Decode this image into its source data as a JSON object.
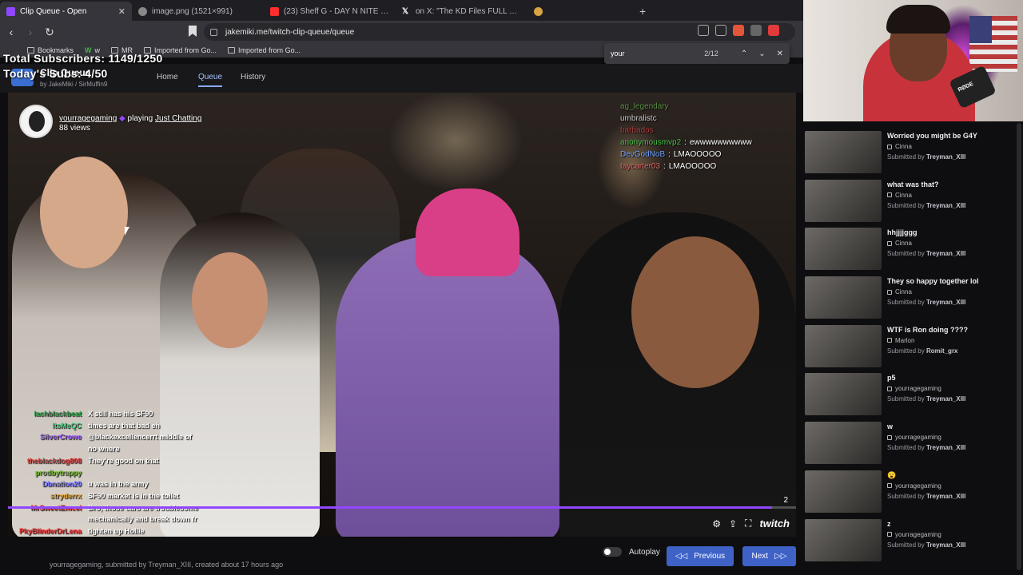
{
  "tabs": [
    {
      "title": "Clip Queue - Open",
      "color": "#9147ff",
      "active": true
    },
    {
      "title": "image.png (1521×991)",
      "color": "#888888"
    },
    {
      "title": "(23) Sheff G - DAY N NITE Freestyle (",
      "color": "#ff2d2d"
    },
    {
      "title": "on X: \"The KD Files FULL THREAD",
      "color": "#ffffff"
    },
    {
      "title": "",
      "color": "#d9a441"
    }
  ],
  "address": {
    "url": "jakemiki.me/twitch-clip-queue/queue"
  },
  "bookmarks": [
    "Bookmarks",
    "w",
    "MR",
    "Imported from Go...",
    "Imported from Go..."
  ],
  "find": {
    "query": "your",
    "count": "2/12"
  },
  "overlay": {
    "total_subs": "Total Subscribers: 1149/1250",
    "todays_subs": "Today's Subs: 4/50"
  },
  "site": {
    "title": "Clip Queue",
    "by": "by",
    "authors": [
      "JakeMiki",
      "SirMuffin9"
    ],
    "nav": [
      "Home",
      "Queue",
      "History"
    ],
    "active_nav": "Queue"
  },
  "clip": {
    "channel": "yourragegaming",
    "playing": "playing",
    "game": "Just Chatting",
    "views": "88 views",
    "progress": 0.97,
    "counter": "2",
    "brand": "twitch"
  },
  "chat_top": [
    {
      "user": "ag_legendary",
      "msg": "",
      "color": "#5a8d46"
    },
    {
      "user": "umbralistc",
      "msg": "",
      "color": "#c9c9c9"
    },
    {
      "user": "barbados",
      "msg": "",
      "color": "#b13b3b"
    },
    {
      "user": "anonymousmvp2",
      "msg": "ewwwwwwwwww",
      "color": "#44c04a"
    },
    {
      "user": "DevGodNoB",
      "msg": "LMAOOOOO",
      "color": "#6aa0ff"
    },
    {
      "user": "taycarter03",
      "msg": "LMAOOOOO",
      "color": "#e06666"
    }
  ],
  "chat_bottom": [
    {
      "user": "lachblackbeat",
      "msg": "X still has his SF90",
      "color": "#2ea54a"
    },
    {
      "user": "ItsMeQC",
      "msg": "times are that bad eh",
      "color": "#39d37a"
    },
    {
      "user": "SilverCrowe",
      "msg": "@blackexcellencerrt middle of",
      "color": "#9b59f6"
    },
    {
      "user": "",
      "msg": "no where",
      "color": "#ffffff"
    },
    {
      "user": "theblackdog808",
      "msg": "They're good on that",
      "color": "#d34545"
    },
    {
      "user": "prodbytrappy",
      "msg": "",
      "color": "#77b43a"
    },
    {
      "user": "Dbnation20",
      "msg": "u was in the army",
      "color": "#7b74ff"
    },
    {
      "user": "stryderrx",
      "msg": "SF90 market is in the toilet",
      "color": "#e0a030"
    },
    {
      "user": "MrSweetEmcel",
      "msg": "Bro, those cars are troublesome",
      "color": "#d33"
    },
    {
      "user": "",
      "msg": "mechanically and break down fr",
      "color": "#ffffff"
    },
    {
      "user": "PkyBlinderDrLena",
      "msg": "tighten up Hollie",
      "color": "#e33"
    },
    {
      "user": "stryderrx",
      "msg": "",
      "color": "#e0a030"
    },
    {
      "user": "ItsMeQC",
      "msg": "o_______o",
      "color": "#39d37a"
    }
  ],
  "footer": {
    "submitted": "yourragegaming, submitted by Treyman_XIII, created about 17 hours ago",
    "autoplay": "Autoplay",
    "previous": "Previous",
    "next": "Next"
  },
  "webcam": {
    "mic_brand": "RØDE"
  },
  "queue": [
    {
      "title": "Worried you might be G4Y",
      "author": "Cinna",
      "submitted_label": "Submitted by",
      "submitter": "Treyman_XIII"
    },
    {
      "title": "what was that?",
      "author": "Cinna",
      "submitted_label": "Submitted by",
      "submitter": "Treyman_XIII"
    },
    {
      "title": "hhjjjjggg",
      "author": "Cinna",
      "submitted_label": "Submitted by",
      "submitter": "Treyman_XIII"
    },
    {
      "title": "They so happy together lol",
      "author": "Cinna",
      "submitted_label": "Submitted by",
      "submitter": "Treyman_XIII"
    },
    {
      "title": "WTF is Ron doing ????",
      "author": "Marlon",
      "submitted_label": "Submitted by",
      "submitter": "Romit_grx"
    },
    {
      "title": "p5",
      "author": "yourragegaming",
      "submitted_label": "Submitted by",
      "submitter": "Treyman_XIII"
    },
    {
      "title": "w",
      "author": "yourragegaming",
      "submitted_label": "Submitted by",
      "submitter": "Treyman_XIII"
    },
    {
      "title": "😮",
      "author": "yourragegaming",
      "submitted_label": "Submitted by",
      "submitter": "Treyman_XIII"
    },
    {
      "title": "z",
      "author": "yourragegaming",
      "submitted_label": "Submitted by",
      "submitter": "Treyman_XIII"
    }
  ]
}
